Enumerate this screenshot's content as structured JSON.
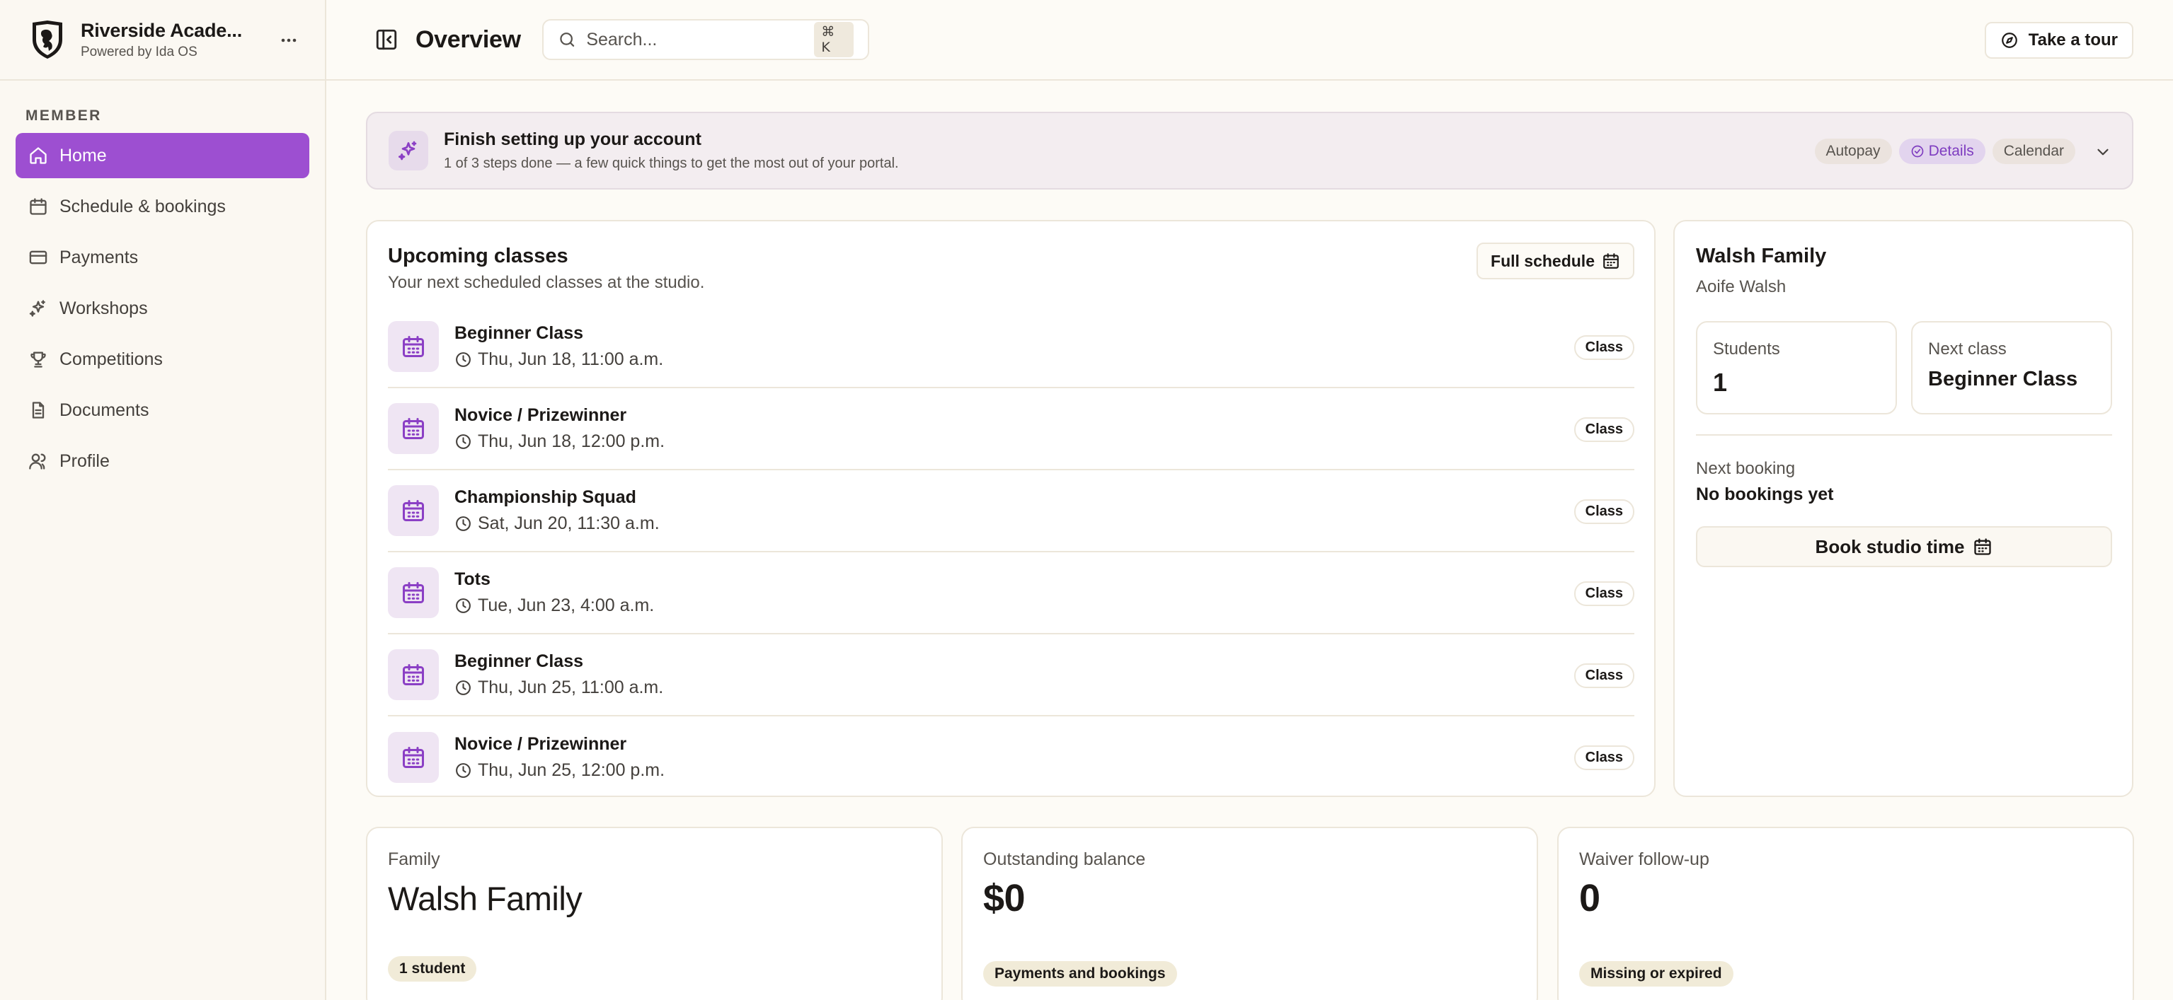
{
  "brand": {
    "name": "Riverside Acade...",
    "powered_by": "Powered by Ida OS"
  },
  "sidebar": {
    "section_label": "MEMBER",
    "items": [
      {
        "label": "Home",
        "icon": "home-icon",
        "active": true
      },
      {
        "label": "Schedule & bookings",
        "icon": "calendar-icon"
      },
      {
        "label": "Payments",
        "icon": "credit-card-icon"
      },
      {
        "label": "Workshops",
        "icon": "sparkle-icon"
      },
      {
        "label": "Competitions",
        "icon": "trophy-icon"
      },
      {
        "label": "Documents",
        "icon": "document-icon"
      },
      {
        "label": "Profile",
        "icon": "users-icon"
      }
    ]
  },
  "header": {
    "title": "Overview",
    "search_placeholder": "Search...",
    "search_shortcut": "⌘ K",
    "tour_label": "Take a tour"
  },
  "setup": {
    "title": "Finish setting up your account",
    "subtitle": "1 of 3 steps done — a few quick things to get the most out of your portal.",
    "steps": [
      {
        "label": "Autopay",
        "done": false
      },
      {
        "label": "Details",
        "done": true
      },
      {
        "label": "Calendar",
        "done": false
      }
    ]
  },
  "upcoming": {
    "title": "Upcoming classes",
    "subtitle": "Your next scheduled classes at the studio.",
    "full_schedule_label": "Full schedule",
    "classes": [
      {
        "name": "Beginner Class",
        "time": "Thu, Jun 18, 11:00 a.m.",
        "badge": "Class"
      },
      {
        "name": "Novice / Prizewinner",
        "time": "Thu, Jun 18, 12:00 p.m.",
        "badge": "Class"
      },
      {
        "name": "Championship Squad",
        "time": "Sat, Jun 20, 11:30 a.m.",
        "badge": "Class"
      },
      {
        "name": "Tots",
        "time": "Tue, Jun 23, 4:00 a.m.",
        "badge": "Class"
      },
      {
        "name": "Beginner Class",
        "time": "Thu, Jun 25, 11:00 a.m.",
        "badge": "Class"
      },
      {
        "name": "Novice / Prizewinner",
        "time": "Thu, Jun 25, 12:00 p.m.",
        "badge": "Class"
      }
    ]
  },
  "family_card": {
    "title": "Walsh Family",
    "member": "Aoife Walsh",
    "students_label": "Students",
    "students_value": "1",
    "next_class_label": "Next class",
    "next_class_value": "Beginner Class",
    "next_booking_label": "Next booking",
    "next_booking_value": "No bookings yet",
    "book_label": "Book studio time"
  },
  "stats": [
    {
      "label": "Family",
      "value": "Walsh Family",
      "pill": "1 student"
    },
    {
      "label": "Outstanding balance",
      "value": "$0",
      "pill": "Payments and bookings"
    },
    {
      "label": "Waiver follow-up",
      "value": "0",
      "pill": "Missing or expired"
    }
  ],
  "colors": {
    "accent": "#9d4fd1",
    "background": "#fdfbf6",
    "banner": "#f3edf0"
  }
}
